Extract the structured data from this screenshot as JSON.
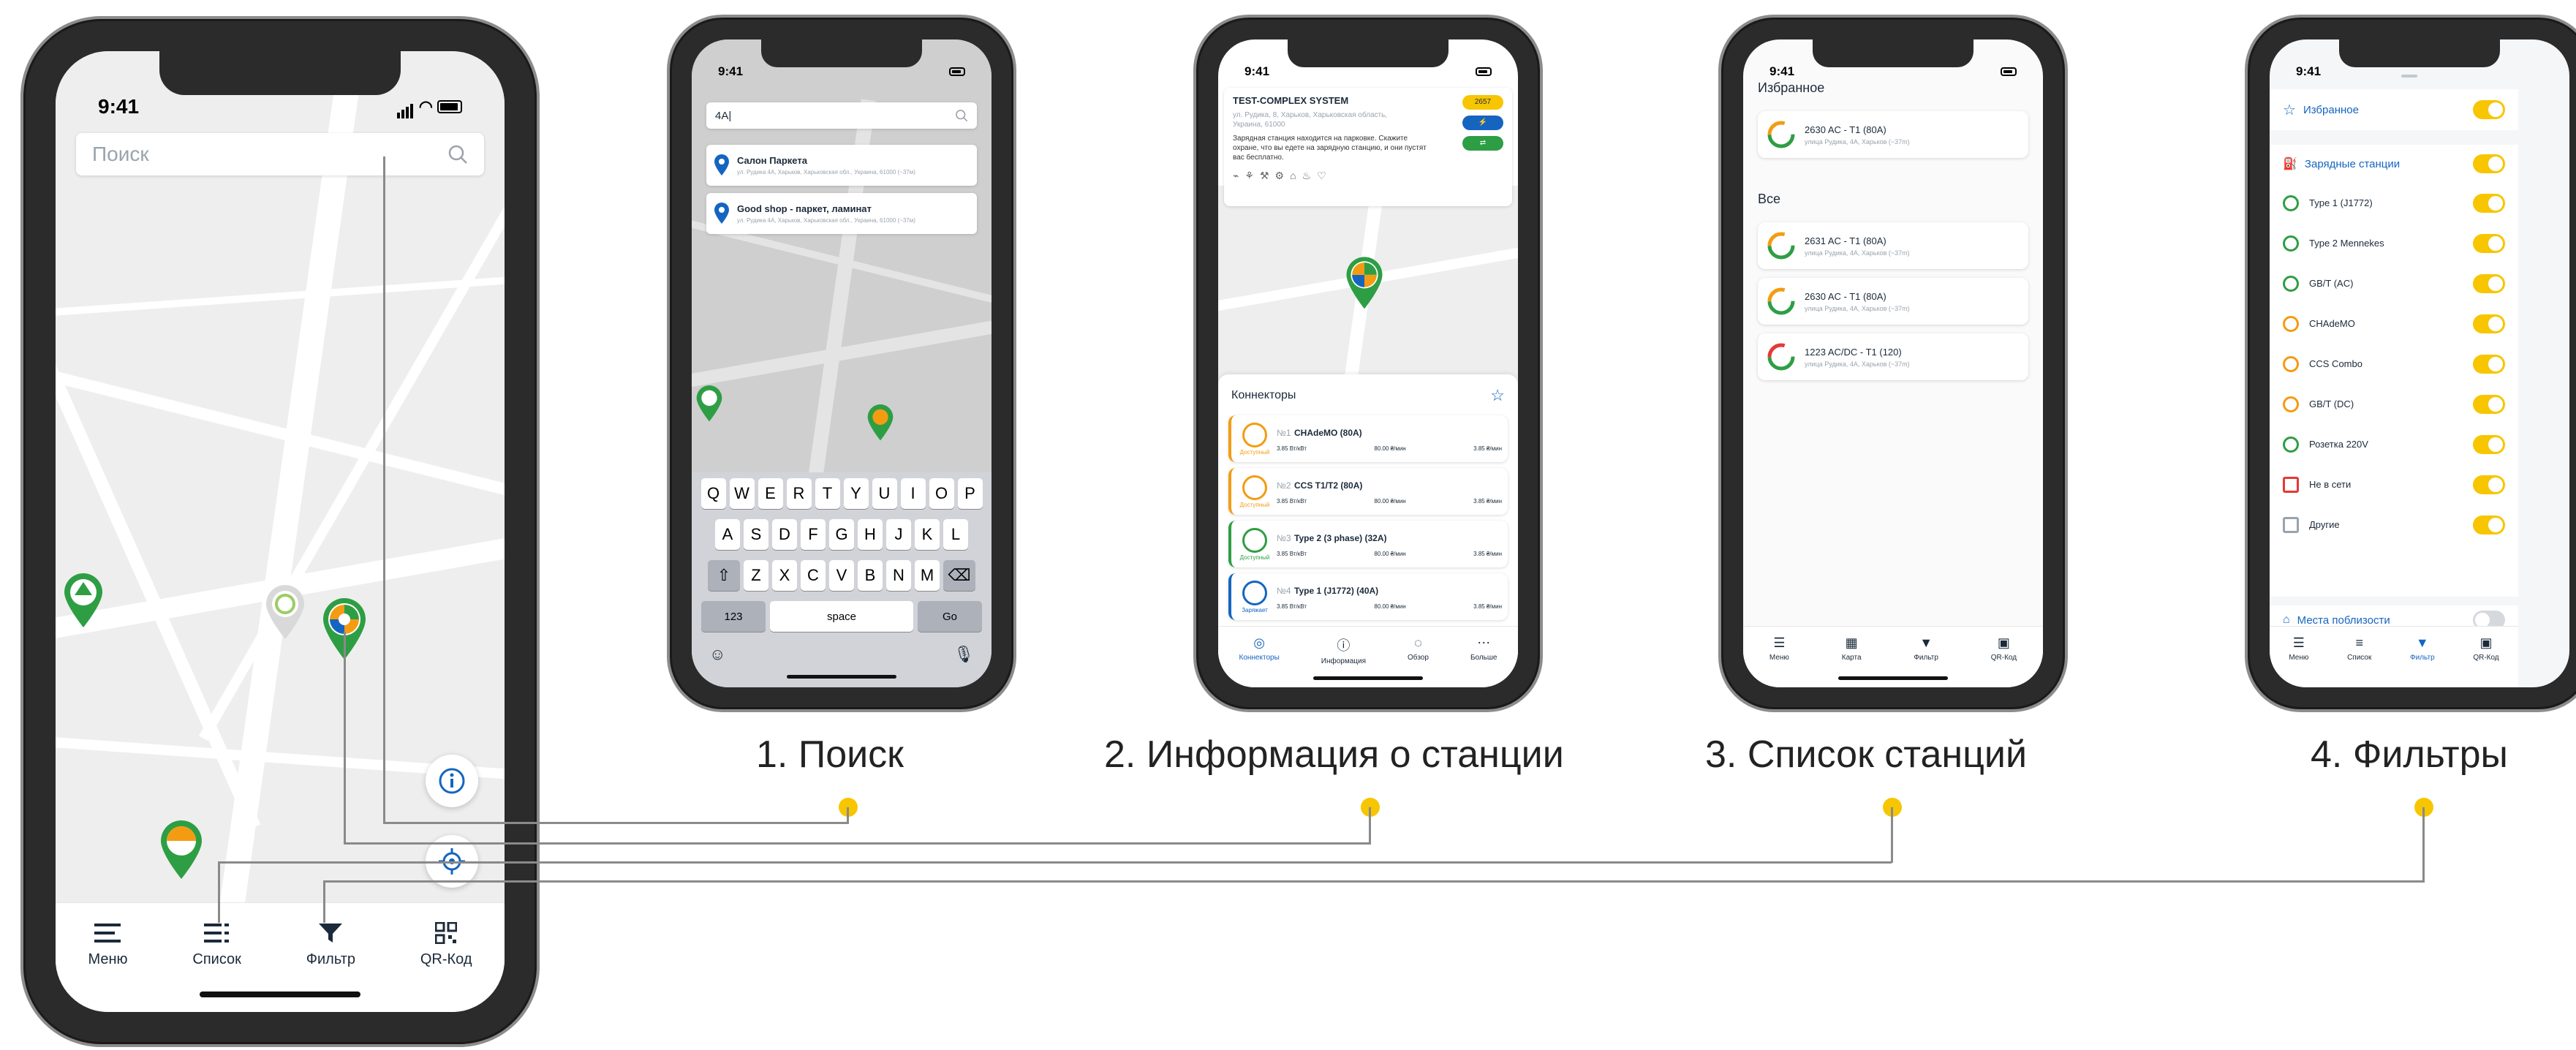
{
  "colors": {
    "accent": "#f7c600",
    "blue": "#1565c0",
    "green": "#2e9e44",
    "orange": "#f39c12"
  },
  "status_time": "9:41",
  "main_phone": {
    "search_placeholder": "Поиск",
    "tabs": [
      {
        "label": "Меню",
        "icon": "menu-icon"
      },
      {
        "label": "Список",
        "icon": "list-icon"
      },
      {
        "label": "Фильтр",
        "icon": "filter-icon"
      },
      {
        "label": "QR-Код",
        "icon": "qr-code-icon"
      }
    ]
  },
  "search_phone": {
    "query": "4А|",
    "results": [
      {
        "title": "Салон Паркета",
        "subtitle": "ул. Рудика 4А, Харьков, Харьковская обл., Украина, 61000 (~37м)"
      },
      {
        "title": "Good shop - паркет, ламинат",
        "subtitle": "ул. Рудика 4А, Харьков, Харьковская обл., Украина, 61000 (~37м)"
      }
    ],
    "keyboard": {
      "row1": [
        "Q",
        "W",
        "E",
        "R",
        "T",
        "Y",
        "U",
        "I",
        "O",
        "P"
      ],
      "row2": [
        "A",
        "S",
        "D",
        "F",
        "G",
        "H",
        "J",
        "K",
        "L"
      ],
      "row3": [
        "Z",
        "X",
        "C",
        "V",
        "B",
        "N",
        "M"
      ],
      "numbers": "123",
      "space": "space",
      "go": "Go"
    }
  },
  "info_phone": {
    "title": "TEST-COMPLEX SYSTEM",
    "address": "ул. Рудика, 8, Харьков, Харьковская область, Украина, 61000",
    "description": "Зарядная станция находится на парковке. Скажите охране, что вы едете на зарядную станцию, и они пустят вас бесплатно.",
    "badge_number": "2657",
    "connectors_title": "Коннекторы",
    "connectors": [
      {
        "num": "№1",
        "name": "CHAdeMO (80A)",
        "status": "Доступный",
        "power": "3.85 Вт/кВт",
        "price": "80.00 ₴/мин",
        "fee": "3.85 ₴/мин",
        "color": "#f39c12"
      },
      {
        "num": "№2",
        "name": "CCS T1/T2 (80A)",
        "status": "Доступный",
        "power": "3.85 Вт/кВт",
        "price": "80.00 ₴/мин",
        "fee": "3.85 ₴/мин",
        "color": "#f39c12"
      },
      {
        "num": "№3",
        "name": "Type 2 (3 phase) (32A)",
        "status": "Доступный",
        "power": "3.85 Вт/кВт",
        "price": "80.00 ₴/мин",
        "fee": "3.85 ₴/мин",
        "color": "#2e9e44"
      },
      {
        "num": "№4",
        "name": "Type 1 (J1772) (40A)",
        "status": "Заряжает",
        "power": "3.85 Вт/кВт",
        "price": "80.00 ₴/мин",
        "fee": "3.85 ₴/мин",
        "color": "#1565c0"
      }
    ],
    "tabs": [
      {
        "label": "Коннекторы",
        "icon": "connector-icon"
      },
      {
        "label": "Информация",
        "icon": "info-icon"
      },
      {
        "label": "Обзор",
        "icon": "comment-icon"
      },
      {
        "label": "Больше",
        "icon": "more-icon"
      }
    ]
  },
  "list_phone": {
    "favorites_title": "Избранное",
    "all_title": "Все",
    "favorites": [
      {
        "name": "2630 AC - T1 (80A)",
        "address": "улица Рудика, 4А, Харьков (~37m)"
      }
    ],
    "all": [
      {
        "name": "2631 AC - T1 (80A)",
        "address": "улица Рудика, 4А, Харьков (~37m)"
      },
      {
        "name": "2630 AC - T1 (80A)",
        "address": "улица Рудика, 4А, Харьков (~37m)"
      },
      {
        "name": "1223 AC/DC - T1 (120)",
        "address": "улица Рудика, 4А, Харьков (~37m)"
      }
    ],
    "tabs": [
      {
        "label": "Меню",
        "icon": "menu-icon"
      },
      {
        "label": "Карта",
        "icon": "map-icon"
      },
      {
        "label": "Фильтр",
        "icon": "filter-icon"
      },
      {
        "label": "QR-Код",
        "icon": "qr-code-icon"
      }
    ]
  },
  "filter_phone": {
    "favorites": "Избранное",
    "stations": "Зарядные станции",
    "nearby": "Места поблизости",
    "items": [
      {
        "label": "Type 1 (J1772)",
        "on": true
      },
      {
        "label": "Type 2 Mennekes",
        "on": true
      },
      {
        "label": "GB/T (AC)",
        "on": true
      },
      {
        "label": "CHAdeMO",
        "on": true
      },
      {
        "label": "CCS Combo",
        "on": true
      },
      {
        "label": "GB/T (DC)",
        "on": true
      },
      {
        "label": "Розетка 220V",
        "on": true
      },
      {
        "label": "Не в сети",
        "on": true
      },
      {
        "label": "Другие",
        "on": true
      }
    ],
    "tabs": [
      {
        "label": "Меню",
        "icon": "menu-icon"
      },
      {
        "label": "Список",
        "icon": "list-icon"
      },
      {
        "label": "Фильтр",
        "icon": "filter-icon"
      },
      {
        "label": "QR-Код",
        "icon": "qr-code-icon"
      }
    ]
  },
  "captions": {
    "c1": "1. Поиск",
    "c2": "2. Информация о станции",
    "c3": "3. Список станций",
    "c4": "4. Фильтры"
  }
}
